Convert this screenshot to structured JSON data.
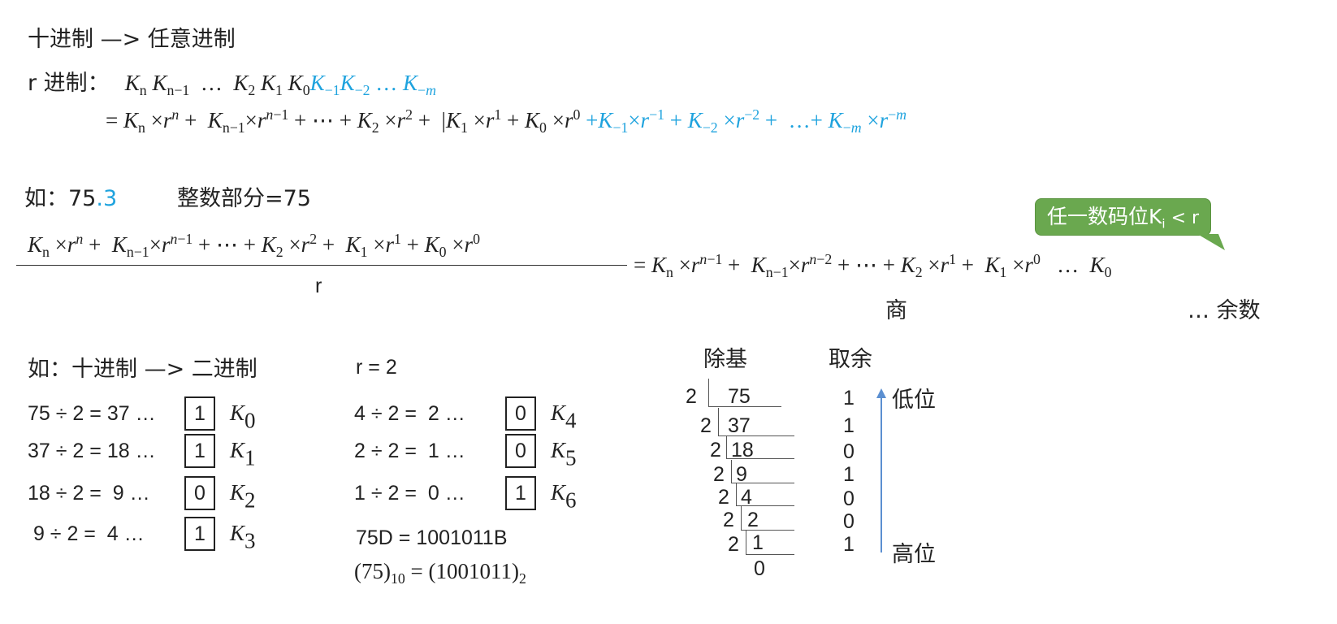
{
  "header": {
    "title": "十进制 —> 任意进制"
  },
  "formula": {
    "radix_label": "r 进制：",
    "digits_black": [
      "K",
      "n",
      "K",
      "n−1",
      "…",
      "K",
      "2",
      "K",
      "1",
      "K",
      "0"
    ],
    "digits_blue": [
      "K",
      "−1",
      "K",
      "−2",
      "…",
      "K",
      "−m"
    ],
    "expand_eq": "=",
    "plus": "+",
    "times_r": "×r",
    "ellipsis": "⋯"
  },
  "example1": {
    "label": "如：75",
    "frac": ".3",
    "integer_part": "整数部分=75"
  },
  "callout": {
    "text": "任一数码位K",
    "sub": "i",
    "tail": " < r",
    "color": "#6aa84f"
  },
  "division": {
    "denominator": "r",
    "quotient_label": "商",
    "remainder_label": "… 余数",
    "ellipsis": "…"
  },
  "example2": {
    "label": "如：十进制 —> 二进制",
    "r_eq": "r = 2",
    "rows_left": [
      {
        "expr": "75 ÷ 2 = 37 …",
        "rem": "1",
        "k": "0"
      },
      {
        "expr": "37 ÷ 2 = 18 …",
        "rem": "1",
        "k": "1"
      },
      {
        "expr": "18 ÷ 2 =  9 …",
        "rem": "0",
        "k": "2"
      },
      {
        "expr": " 9 ÷ 2 =  4 …",
        "rem": "1",
        "k": "3"
      }
    ],
    "rows_right": [
      {
        "expr": "4 ÷ 2 =  2 …",
        "rem": "0",
        "k": "4"
      },
      {
        "expr": "2 ÷ 2 =  1 …",
        "rem": "0",
        "k": "5"
      },
      {
        "expr": "1 ÷ 2 =  0 …",
        "rem": "1",
        "k": "6"
      }
    ],
    "result1": "75D = 1001011B",
    "result2_a": "(75)",
    "result2_a_sub": "10",
    "result2_b": " = (1001011)",
    "result2_b_sub": "2"
  },
  "long_division": {
    "header_divide": "除基",
    "header_take": "取余",
    "divisor": "2",
    "quotients": [
      "75",
      "37",
      "18",
      "9",
      "4",
      "2",
      "1"
    ],
    "final": "0",
    "remainders": [
      "1",
      "1",
      "0",
      "1",
      "0",
      "0",
      "1"
    ],
    "low_label": "低位",
    "high_label": "高位",
    "arrow_color": "#5b8fd1"
  }
}
